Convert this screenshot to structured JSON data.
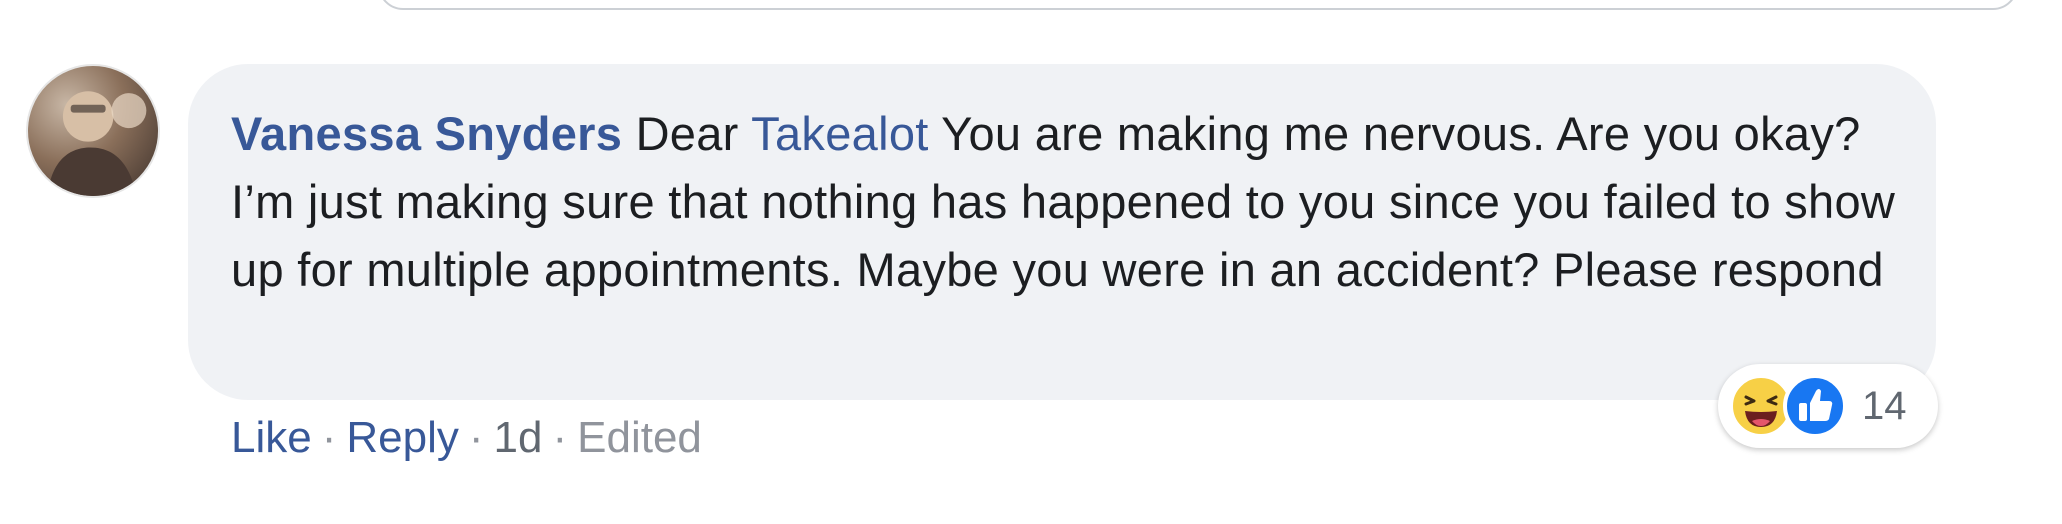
{
  "comment": {
    "author": "Vanessa Snyders",
    "text_before_mention": "Dear",
    "mention": "Takealot",
    "text_after_mention": "You are making me nervous. Are you okay? I’m just making sure that nothing has happened to you since you failed to show up for multiple appointments. Maybe you were in an accident? Please respond",
    "reactions": {
      "icons": [
        "haha-emoji-icon",
        "like-thumb-icon"
      ],
      "count": "14"
    },
    "actions": {
      "like_label": "Like",
      "reply_label": "Reply",
      "separator": "·",
      "time": "1d",
      "edited_label": "Edited"
    }
  },
  "colors": {
    "link_blue": "#385898",
    "bubble_bg": "#f0f2f5",
    "text": "#1c1e21",
    "muted": "#90949c",
    "like_blue": "#1877f2",
    "haha_yellow": "#f7d046"
  }
}
